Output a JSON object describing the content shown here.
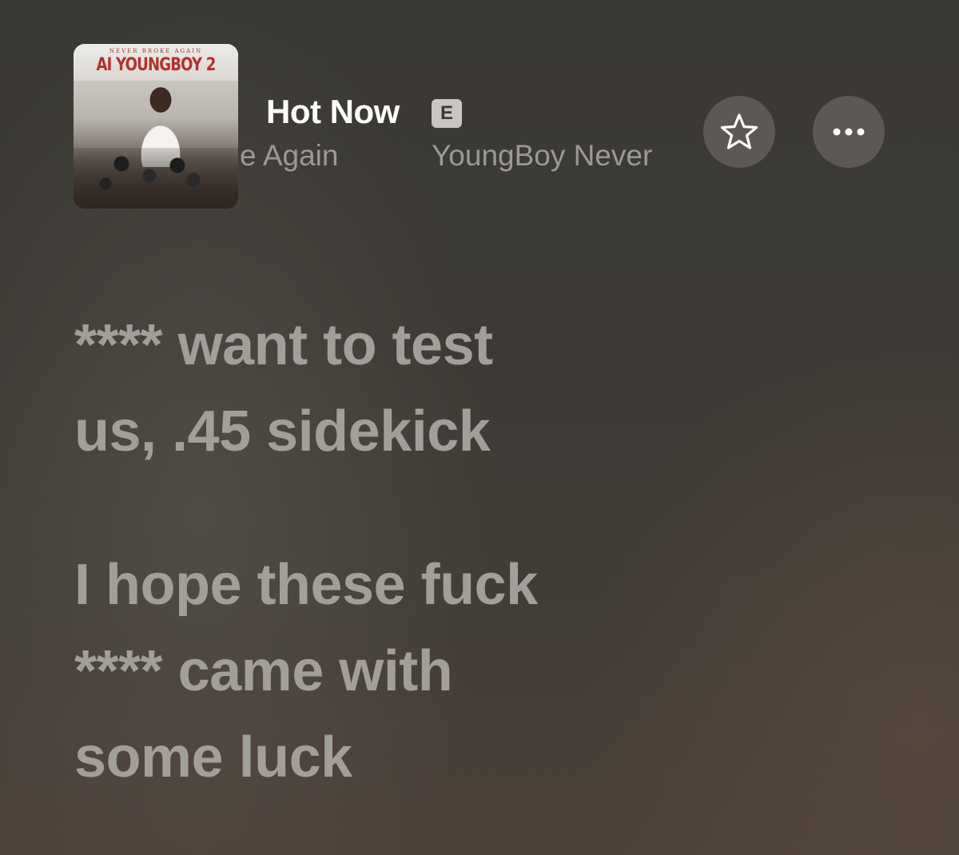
{
  "now_playing": {
    "artwork": {
      "tagline": "NEVER BROKE AGAIN",
      "title": "AI YOUNGBOY 2"
    },
    "title": "Hot Now",
    "explicit_badge": "E",
    "album_partial": "e Again",
    "artist_partial": "YoungBoy Never",
    "favorite_icon": "star-icon",
    "more_icon": "ellipsis-icon"
  },
  "lyrics": {
    "verse1": [
      "**** want to test",
      "us, .45 sidekick"
    ],
    "verse2": [
      "I hope these fuck",
      "**** came with",
      "some luck"
    ]
  },
  "colors": {
    "title": "#ffffff",
    "subtitle": "#9c9994",
    "lyric": "#a29f9a",
    "button_bg": "#76726c"
  }
}
